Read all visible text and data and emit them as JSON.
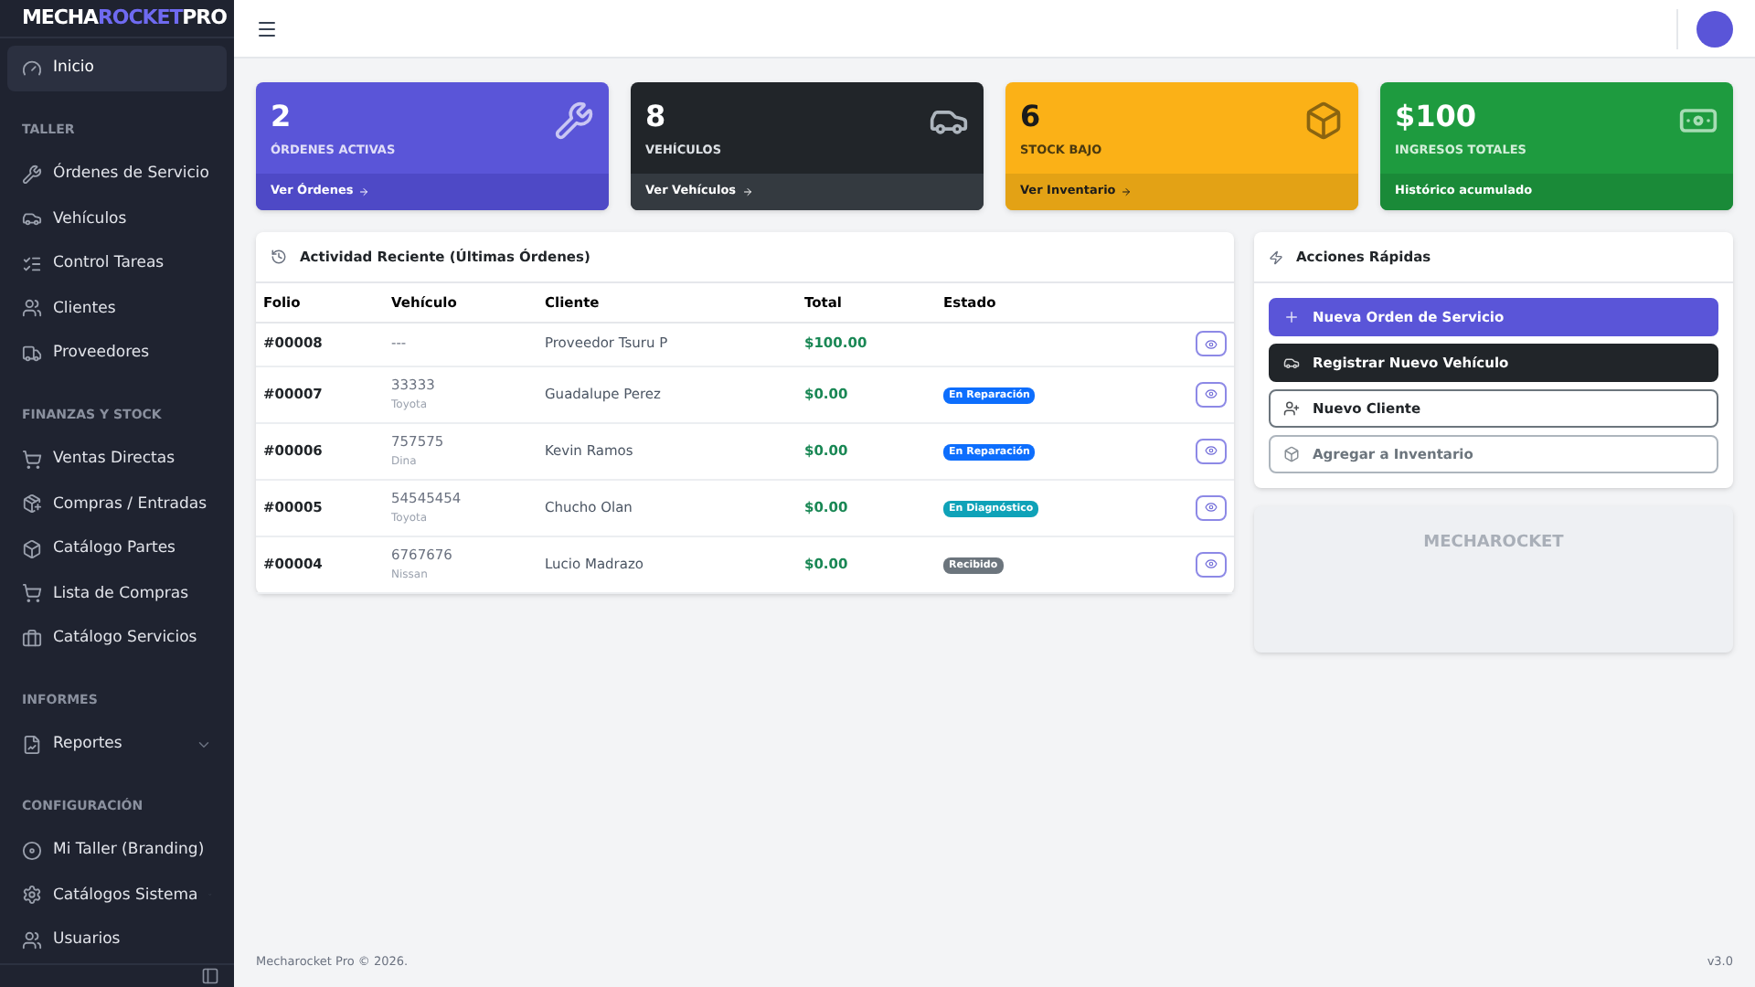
{
  "brand": {
    "part_1": "MECHA",
    "part_2": "ROCKET",
    "part_3": "PRO"
  },
  "sidebar": {
    "groups": [
      {
        "items": [
          {
            "label": "Inicio",
            "selected": true,
            "has_submenu": false
          }
        ]
      },
      {
        "title": "TALLER",
        "items": [
          {
            "label": "Órdenes de Servicio",
            "selected": false,
            "has_submenu": false
          },
          {
            "label": "Vehículos",
            "selected": false,
            "has_submenu": false
          },
          {
            "label": "Control Tareas",
            "selected": false,
            "has_submenu": false
          },
          {
            "label": "Clientes",
            "selected": false,
            "has_submenu": false
          },
          {
            "label": "Proveedores",
            "selected": false,
            "has_submenu": false
          }
        ]
      },
      {
        "title": "FINANZAS Y STOCK",
        "items": [
          {
            "label": "Ventas Directas",
            "selected": false,
            "has_submenu": false
          },
          {
            "label": "Compras / Entradas",
            "selected": false,
            "has_submenu": false
          },
          {
            "label": "Catálogo Partes",
            "selected": false,
            "has_submenu": false
          },
          {
            "label": "Lista de Compras",
            "selected": false,
            "has_submenu": false
          },
          {
            "label": "Catálogo Servicios",
            "selected": false,
            "has_submenu": false
          }
        ]
      },
      {
        "title": "INFORMES",
        "items": [
          {
            "label": "Reportes",
            "selected": false,
            "has_submenu": true
          }
        ]
      },
      {
        "title": "CONFIGURACIÓN",
        "items": [
          {
            "label": "Mi Taller (Branding)",
            "selected": false,
            "has_submenu": false
          },
          {
            "label": "Catálogos Sistema",
            "selected": false,
            "has_submenu": true
          },
          {
            "label": "Usuarios",
            "selected": false,
            "has_submenu": false
          }
        ]
      }
    ]
  },
  "stats": [
    {
      "kind": "primary",
      "value": "2",
      "label": "ÓRDENES ACTIVAS",
      "footer": "Ver Órdenes",
      "link": true
    },
    {
      "kind": "dark",
      "value": "8",
      "label": "VEHÍCULOS",
      "footer": "Ver Vehículos",
      "link": true
    },
    {
      "kind": "warning",
      "value": "6",
      "label": "STOCK BAJO",
      "footer": "Ver Inventario",
      "link": true
    },
    {
      "kind": "success",
      "value": "$100",
      "label": "INGRESOS TOTALES",
      "footer": "Histórico acumulado",
      "link": false
    }
  ],
  "recent": {
    "title": "Actividad Reciente (Últimas Órdenes)",
    "columns": [
      "Folio",
      "Vehículo",
      "Cliente",
      "Total",
      "Estado"
    ],
    "rows": [
      {
        "folio": "#00008",
        "vehicle": "---",
        "client": "Proveedor Tsuru P",
        "total": "$100.00"
      },
      {
        "folio": "#00007",
        "vehicle": "33333",
        "vehicle_sub": "Toyota",
        "client": "Guadalupe Perez",
        "total": "$0.00",
        "status": {
          "label": "En Reparación",
          "color": "#0d6efd"
        }
      },
      {
        "folio": "#00006",
        "vehicle": "757575",
        "vehicle_sub": "Dina",
        "client": "Kevin Ramos",
        "total": "$0.00",
        "status": {
          "label": "En Reparación",
          "color": "#0d6efd"
        }
      },
      {
        "folio": "#00005",
        "vehicle": "54545454",
        "vehicle_sub": "Toyota",
        "client": "Chucho Olan",
        "total": "$0.00",
        "status": {
          "label": "En Diagnóstico",
          "color": "#0fa2b8"
        }
      },
      {
        "folio": "#00004",
        "vehicle": "6767676",
        "vehicle_sub": "Nissan",
        "client": "Lucio Madrazo",
        "total": "$0.00",
        "status": {
          "label": "Recibido",
          "color": "#6c757d"
        }
      }
    ]
  },
  "quick_actions": {
    "title": "Acciones Rápidas",
    "buttons": [
      {
        "kind": "primary",
        "label": "Nueva Orden de Servicio"
      },
      {
        "kind": "dark",
        "label": "Registrar Nuevo Vehículo"
      },
      {
        "kind": "outline",
        "label": "Nuevo Cliente"
      },
      {
        "kind": "outline-muted",
        "label": "Agregar a Inventario"
      }
    ]
  },
  "promo": {
    "title": "MECHAROCKET"
  },
  "footer": {
    "copyright": "Mecharocket Pro © 2026.",
    "version": "v3.0"
  }
}
